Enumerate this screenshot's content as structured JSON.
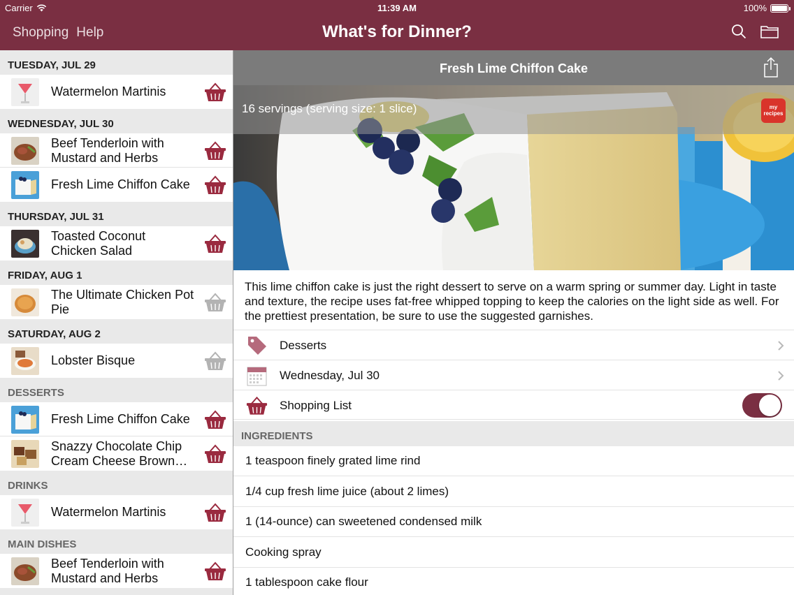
{
  "status": {
    "carrier": "Carrier",
    "time": "11:39 AM",
    "battery": "100%",
    "battery_level": 1.0
  },
  "nav": {
    "left_links": [
      "Shopping",
      "Help"
    ],
    "title": "What's for Dinner?"
  },
  "colors": {
    "brand": "#7a2f42",
    "basket_active": "#9a2a3f",
    "basket_inactive": "#b3b3b3"
  },
  "sections": [
    {
      "header": "TUESDAY, JUL 29",
      "kind": "date",
      "items": [
        {
          "name": "Watermelon Martinis",
          "thumb": "martini",
          "in_list": true
        }
      ]
    },
    {
      "header": "WEDNESDAY, JUL 30",
      "kind": "date",
      "items": [
        {
          "name": "Beef Tenderloin with Mustard and Herbs",
          "thumb": "beef",
          "in_list": true
        },
        {
          "name": "Fresh Lime Chiffon Cake",
          "thumb": "cake",
          "in_list": true
        }
      ]
    },
    {
      "header": "THURSDAY, JUL 31",
      "kind": "date",
      "items": [
        {
          "name": "Toasted Coconut Chicken Salad",
          "thumb": "salad",
          "in_list": true
        }
      ]
    },
    {
      "header": "FRIDAY, AUG 1",
      "kind": "date",
      "items": [
        {
          "name": "The Ultimate Chicken Pot Pie",
          "thumb": "potpie",
          "in_list": false
        }
      ]
    },
    {
      "header": "SATURDAY, AUG 2",
      "kind": "date",
      "items": [
        {
          "name": "Lobster Bisque",
          "thumb": "bisque",
          "in_list": false
        }
      ]
    },
    {
      "header": "DESSERTS",
      "kind": "category",
      "items": [
        {
          "name": "Fresh Lime Chiffon Cake",
          "thumb": "cake",
          "in_list": true
        },
        {
          "name": "Snazzy Chocolate Chip Cream Cheese Brown…",
          "thumb": "brownie",
          "in_list": true
        }
      ]
    },
    {
      "header": "DRINKS",
      "kind": "category",
      "items": [
        {
          "name": "Watermelon Martinis",
          "thumb": "martini",
          "in_list": true
        }
      ]
    },
    {
      "header": "MAIN DISHES",
      "kind": "category",
      "items": [
        {
          "name": "Beef Tenderloin with Mustard and Herbs",
          "thumb": "beef",
          "in_list": true
        }
      ]
    }
  ],
  "recipe": {
    "title": "Fresh Lime Chiffon Cake",
    "servings": "16 servings (serving size: 1 slice)",
    "brand_badge": "my recipes",
    "description": "This lime chiffon cake is just the right dessert to serve on a warm spring or summer day. Light in taste and texture, the recipe uses fat-free whipped topping to keep the calories on the light side as well. For the prettiest presentation, be sure to use the suggested garnishes.",
    "category": "Desserts",
    "date": "Wednesday, Jul 30",
    "shopping_label": "Shopping List",
    "shopping_on": true,
    "ingredients_header": "INGREDIENTS",
    "ingredients": [
      "1 teaspoon finely grated lime rind",
      "1/4 cup fresh lime juice (about 2 limes)",
      "1 (14-ounce) can sweetened condensed milk",
      "Cooking spray",
      "1 tablespoon cake flour"
    ]
  }
}
